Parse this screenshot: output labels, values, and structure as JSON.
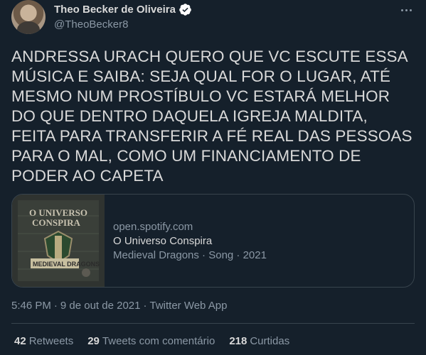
{
  "author": {
    "display_name": "Theo Becker de Oliveira",
    "handle": "@TheoBecker8",
    "verified": true
  },
  "tweet": {
    "text": "ANDRESSA URACH QUERO QUE VC ESCUTE ESSA MÚSICA E SAIBA: SEJA QUAL FOR O LUGAR, ATÉ MESMO NUM PROSTÍBULO VC ESTARÁ MELHOR DO QUE DENTRO DAQUELA IGREJA MALDITA, FEITA PARA TRANSFERIR A FÉ REAL DAS PESSOAS PARA O MAL, COMO UM FINANCIAMENTO DE PODER AO CAPETA"
  },
  "card": {
    "domain": "open.spotify.com",
    "title": "O Universo Conspira",
    "description": "Medieval Dragons · Song · 2021",
    "thumb_text_top": "O UNIVERSO CONSPIRA",
    "thumb_text_bottom": "MEDIEVAL DRAGONS"
  },
  "meta": {
    "time": "5:46 PM",
    "separator": "·",
    "date": "9 de out de 2021",
    "source": "Twitter Web App"
  },
  "stats": [
    {
      "count": "42",
      "label": "Retweets"
    },
    {
      "count": "29",
      "label": "Tweets com comentário"
    },
    {
      "count": "218",
      "label": "Curtidas"
    }
  ],
  "colors": {
    "background": "#15202b",
    "text_primary": "#d9d9d9",
    "text_secondary": "#8b98a5",
    "border": "#38444d",
    "verified": "#ffffff"
  }
}
